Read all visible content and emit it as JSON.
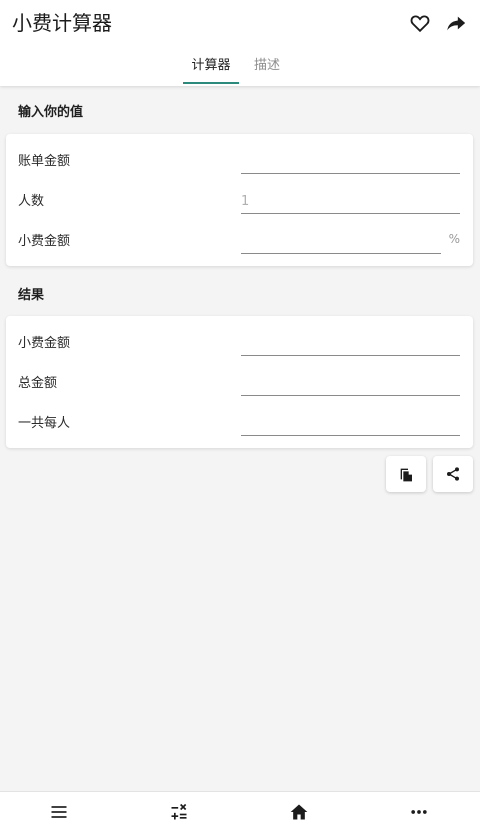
{
  "app": {
    "title": "小费计算器"
  },
  "top_actions": {
    "favorite_icon": "heart-outline-icon",
    "share_icon": "forward-arrow-icon"
  },
  "tabs": [
    {
      "label": "计算器",
      "active": true
    },
    {
      "label": "描述",
      "active": false
    }
  ],
  "input_section": {
    "title": "输入你的值",
    "fields": [
      {
        "label": "账单金额",
        "value": "",
        "placeholder": ""
      },
      {
        "label": "人数",
        "value": "",
        "placeholder": "1"
      },
      {
        "label": "小费金额",
        "value": "",
        "placeholder": "",
        "unit": "%"
      }
    ]
  },
  "result_section": {
    "title": "结果",
    "fields": [
      {
        "label": "小费金额",
        "value": ""
      },
      {
        "label": "总金额",
        "value": ""
      },
      {
        "label": "一共每人",
        "value": ""
      }
    ]
  },
  "result_actions": {
    "copy_icon": "copy-file-icon",
    "share_icon": "share-icon"
  },
  "bottom_nav": [
    {
      "icon": "menu-icon"
    },
    {
      "icon": "calculator-icon"
    },
    {
      "icon": "home-icon"
    },
    {
      "icon": "more-icon"
    }
  ],
  "colors": {
    "accent": "#2c8a7d",
    "background": "#f4f4f4",
    "card": "#ffffff"
  }
}
